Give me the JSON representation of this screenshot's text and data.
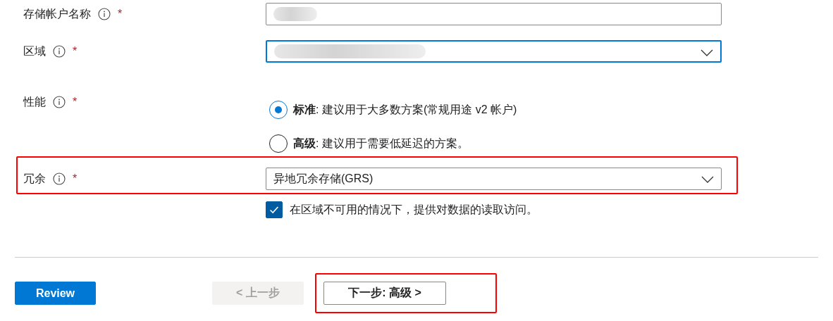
{
  "fields": [
    {
      "kind": "text",
      "label": "存储帐户名称",
      "required_mark": "*",
      "focused": false,
      "redacted": true,
      "highlighted": false
    },
    {
      "kind": "dropdown",
      "label": "区域",
      "required_mark": "*",
      "focused": true,
      "redacted": true,
      "highlighted": false
    },
    {
      "kind": "radio",
      "label": "性能",
      "required_mark": "*",
      "highlighted": false,
      "options": [
        {
          "text": "**标准**: 建议用于大多数方案(常规用途 v2 帐户)",
          "selected": true
        },
        {
          "text": "**高级**: 建议用于需要低延迟的方案。",
          "selected": false
        }
      ]
    },
    {
      "kind": "dropdown",
      "label": "冗余",
      "required_mark": "*",
      "focused": false,
      "value": "异地冗余存储(GRS)",
      "highlighted": true
    },
    {
      "kind": "checkbox",
      "text": "在区域不可用的情况下，提供对数据的读取访问。",
      "checked": true
    }
  ],
  "buttons": [
    {
      "kind": "primary",
      "label": "Review",
      "disabled": false,
      "highlighted": false
    },
    {
      "kind": "secondary",
      "label": "< 上一步",
      "disabled": true,
      "highlighted": false
    },
    {
      "kind": "secondary",
      "label": "下一步: 高级 >",
      "disabled": false,
      "highlighted": true
    }
  ]
}
